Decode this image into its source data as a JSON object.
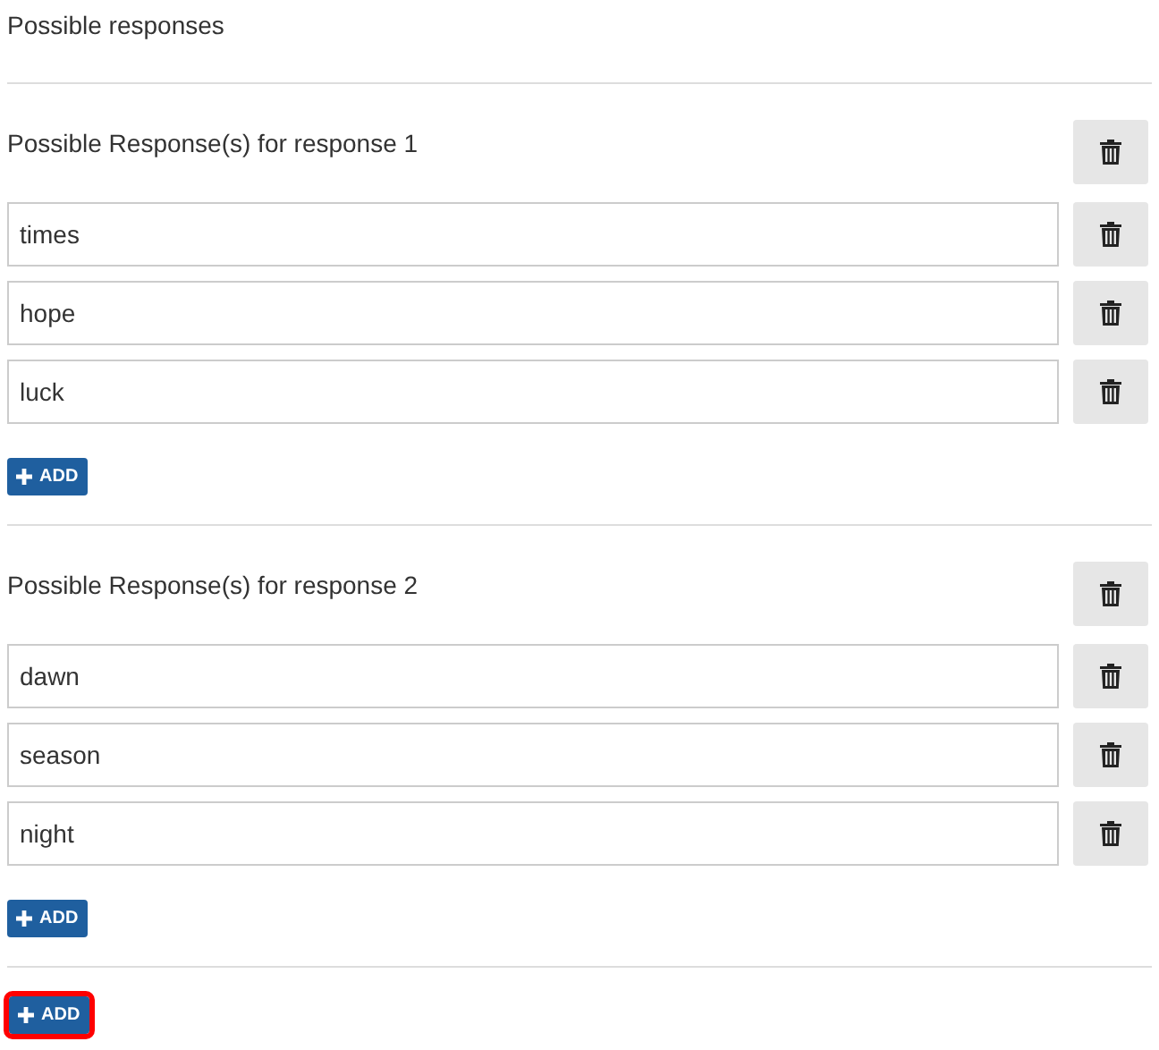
{
  "title": "Possible responses",
  "groups": [
    {
      "heading": "Possible Response(s) for response 1",
      "responses": [
        "times",
        "hope",
        "luck"
      ],
      "add_label": "ADD"
    },
    {
      "heading": "Possible Response(s) for response 2",
      "responses": [
        "dawn",
        "season",
        "night"
      ],
      "add_label": "ADD"
    }
  ],
  "add_button": {
    "label": "ADD",
    "highlighted": true
  }
}
